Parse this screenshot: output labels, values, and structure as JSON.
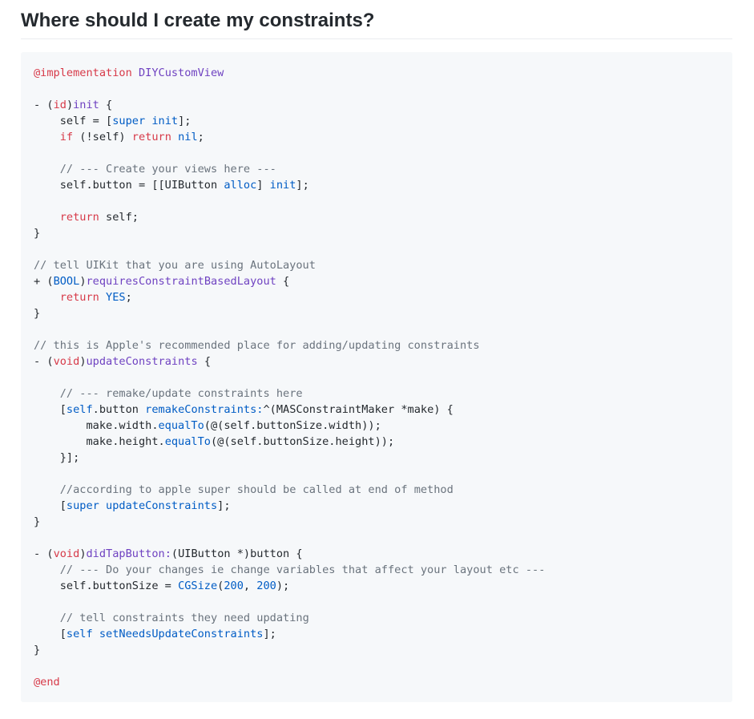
{
  "section": {
    "heading": "Where should I create my constraints?"
  },
  "code": {
    "lines": [
      [
        {
          "t": "k",
          "s": "@implementation"
        },
        {
          "t": "p",
          "s": " "
        },
        {
          "t": "f",
          "s": "DIYCustomView"
        }
      ],
      [],
      [
        {
          "t": "p",
          "s": "- ("
        },
        {
          "t": "k",
          "s": "id"
        },
        {
          "t": "p",
          "s": ")"
        },
        {
          "t": "f",
          "s": "init"
        },
        {
          "t": "p",
          "s": " {"
        }
      ],
      [
        {
          "t": "p",
          "s": "    self = ["
        },
        {
          "t": "v",
          "s": "super"
        },
        {
          "t": "p",
          "s": " "
        },
        {
          "t": "v",
          "s": "init"
        },
        {
          "t": "p",
          "s": "];"
        }
      ],
      [
        {
          "t": "p",
          "s": "    "
        },
        {
          "t": "k",
          "s": "if"
        },
        {
          "t": "p",
          "s": " (!self) "
        },
        {
          "t": "k",
          "s": "return"
        },
        {
          "t": "p",
          "s": " "
        },
        {
          "t": "v",
          "s": "nil"
        },
        {
          "t": "p",
          "s": ";"
        }
      ],
      [],
      [
        {
          "t": "p",
          "s": "    "
        },
        {
          "t": "c",
          "s": "// --- Create your views here ---"
        }
      ],
      [
        {
          "t": "p",
          "s": "    self.button = [[UIButton "
        },
        {
          "t": "v",
          "s": "alloc"
        },
        {
          "t": "p",
          "s": "] "
        },
        {
          "t": "v",
          "s": "init"
        },
        {
          "t": "p",
          "s": "];"
        }
      ],
      [],
      [
        {
          "t": "p",
          "s": "    "
        },
        {
          "t": "k",
          "s": "return"
        },
        {
          "t": "p",
          "s": " self;"
        }
      ],
      [
        {
          "t": "p",
          "s": "}"
        }
      ],
      [],
      [
        {
          "t": "c",
          "s": "// tell UIKit that you are using AutoLayout"
        }
      ],
      [
        {
          "t": "p",
          "s": "+ ("
        },
        {
          "t": "v",
          "s": "BOOL"
        },
        {
          "t": "p",
          "s": ")"
        },
        {
          "t": "f",
          "s": "requiresConstraintBasedLayout"
        },
        {
          "t": "p",
          "s": " {"
        }
      ],
      [
        {
          "t": "p",
          "s": "    "
        },
        {
          "t": "k",
          "s": "return"
        },
        {
          "t": "p",
          "s": " "
        },
        {
          "t": "v",
          "s": "YES"
        },
        {
          "t": "p",
          "s": ";"
        }
      ],
      [
        {
          "t": "p",
          "s": "}"
        }
      ],
      [],
      [
        {
          "t": "c",
          "s": "// this is Apple's recommended place for adding/updating constraints"
        }
      ],
      [
        {
          "t": "p",
          "s": "- ("
        },
        {
          "t": "k",
          "s": "void"
        },
        {
          "t": "p",
          "s": ")"
        },
        {
          "t": "f",
          "s": "updateConstraints"
        },
        {
          "t": "p",
          "s": " {"
        }
      ],
      [],
      [
        {
          "t": "p",
          "s": "    "
        },
        {
          "t": "c",
          "s": "// --- remake/update constraints here"
        }
      ],
      [
        {
          "t": "p",
          "s": "    ["
        },
        {
          "t": "v",
          "s": "self"
        },
        {
          "t": "p",
          "s": ".button "
        },
        {
          "t": "v",
          "s": "remakeConstraints:"
        },
        {
          "t": "p",
          "s": "^(MASConstraintMaker *make) {"
        }
      ],
      [
        {
          "t": "p",
          "s": "        make.width."
        },
        {
          "t": "v",
          "s": "equalTo"
        },
        {
          "t": "p",
          "s": "(@(self.buttonSize.width));"
        }
      ],
      [
        {
          "t": "p",
          "s": "        make.height."
        },
        {
          "t": "v",
          "s": "equalTo"
        },
        {
          "t": "p",
          "s": "(@(self.buttonSize.height));"
        }
      ],
      [
        {
          "t": "p",
          "s": "    }];"
        }
      ],
      [],
      [
        {
          "t": "p",
          "s": "    "
        },
        {
          "t": "c",
          "s": "//according to apple super should be called at end of method"
        }
      ],
      [
        {
          "t": "p",
          "s": "    ["
        },
        {
          "t": "v",
          "s": "super"
        },
        {
          "t": "p",
          "s": " "
        },
        {
          "t": "v",
          "s": "updateConstraints"
        },
        {
          "t": "p",
          "s": "];"
        }
      ],
      [
        {
          "t": "p",
          "s": "}"
        }
      ],
      [],
      [
        {
          "t": "p",
          "s": "- ("
        },
        {
          "t": "k",
          "s": "void"
        },
        {
          "t": "p",
          "s": ")"
        },
        {
          "t": "f",
          "s": "didTapButton:"
        },
        {
          "t": "p",
          "s": "(UIButton *)button {"
        }
      ],
      [
        {
          "t": "p",
          "s": "    "
        },
        {
          "t": "c",
          "s": "// --- Do your changes ie change variables that affect your layout etc ---"
        }
      ],
      [
        {
          "t": "p",
          "s": "    self.buttonSize = "
        },
        {
          "t": "v",
          "s": "CGSize"
        },
        {
          "t": "p",
          "s": "("
        },
        {
          "t": "v",
          "s": "200"
        },
        {
          "t": "p",
          "s": ", "
        },
        {
          "t": "v",
          "s": "200"
        },
        {
          "t": "p",
          "s": ");"
        }
      ],
      [],
      [
        {
          "t": "p",
          "s": "    "
        },
        {
          "t": "c",
          "s": "// tell constraints they need updating"
        }
      ],
      [
        {
          "t": "p",
          "s": "    ["
        },
        {
          "t": "v",
          "s": "self"
        },
        {
          "t": "p",
          "s": " "
        },
        {
          "t": "v",
          "s": "setNeedsUpdateConstraints"
        },
        {
          "t": "p",
          "s": "];"
        }
      ],
      [
        {
          "t": "p",
          "s": "}"
        }
      ],
      [],
      [
        {
          "t": "k",
          "s": "@end"
        }
      ]
    ]
  }
}
